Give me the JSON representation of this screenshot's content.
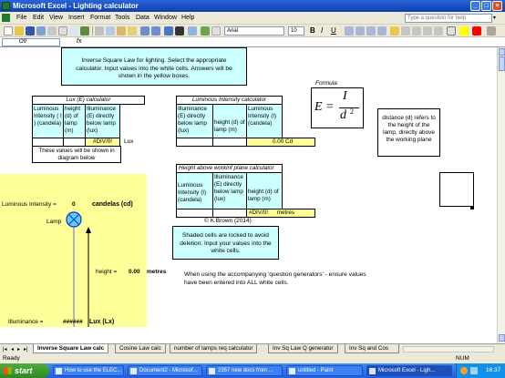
{
  "window": {
    "title": "Microsoft Excel - Lighting calculator"
  },
  "menu": [
    "File",
    "Edit",
    "View",
    "Insert",
    "Format",
    "Tools",
    "Data",
    "Window",
    "Help"
  ],
  "help_placeholder": "Type a question for help",
  "toolbar": {
    "font": "Arial",
    "size": "10",
    "bold": "B"
  },
  "formula_bar": {
    "cell_ref": "O9",
    "fx": "fx"
  },
  "instructions": "Inverse Square Law for lighting. Select the appropriate calculator. Input values into the white cells. Answers will be shown in the yellow boxes.",
  "formula": {
    "label": "Formula",
    "numerator": "I",
    "denominator": "d",
    "exponent": "2",
    "lhs": "E ="
  },
  "distance_note": "distance (d) refers to the height of the lamp, directly above the working plane",
  "lux_calc": {
    "title": "Lux (E) calculator",
    "headers": [
      "Luminous Intensity ( I ) (candela)",
      "height (d) of lamp (m)",
      "Illuminance (E) directly below lamp (lux)"
    ],
    "result": "#DIV/0!",
    "unit": "Lux",
    "note": "These values will be shown in diagram below"
  },
  "intensity_calc": {
    "title": "Luminous Intensity calculator",
    "headers": [
      "Illuminance (E) directly below lamp (lux)",
      "height (d) of lamp (m)",
      "Luminous Intensity (I) (candela)"
    ],
    "result": "0.00",
    "unit": "Cd"
  },
  "height_calc": {
    "title": "Height above workinf plane calculator",
    "headers": [
      "Luminous Intensity (I) (candela)",
      "Illuminance (E) directly below lamp (lux)",
      "height (d) of lamp (m)"
    ],
    "result": "#DIV/0!",
    "unit": "metres"
  },
  "copyright": "© K.Brown (2014)",
  "shaded_note": "Shaded cells are locked to avoid deletion. Input your values into the white cells.",
  "question_note": "When using the accompanying 'question generators' - ensure values have been entered into ALL white cells.",
  "diagram": {
    "intensity_label": "Luminous Intensity =",
    "intensity_value": "0",
    "intensity_unit": "candelas (cd)",
    "lamp_label": "Lamp",
    "height_label": "height =",
    "height_value": "0.00",
    "height_unit": "metres",
    "illum_label": "Illuminance =",
    "illum_value": "######",
    "illum_unit": "Lux (Lx)"
  },
  "tabs": [
    "Inverse Square Law calc",
    "Cosine Law calc",
    "number of lamps req calculator",
    "Inv Sq Law Q generator",
    "Inv Sq and Cos"
  ],
  "status": {
    "left": "Ready",
    "num": "NUM"
  },
  "taskbar": {
    "start": "start",
    "items": [
      "How to use the ELEC...",
      "Document2 - Microsof...",
      "2357 new docs from ...",
      "untitled - Paint",
      "Microsoft Excel - Ligh..."
    ],
    "clock": "16:37"
  }
}
